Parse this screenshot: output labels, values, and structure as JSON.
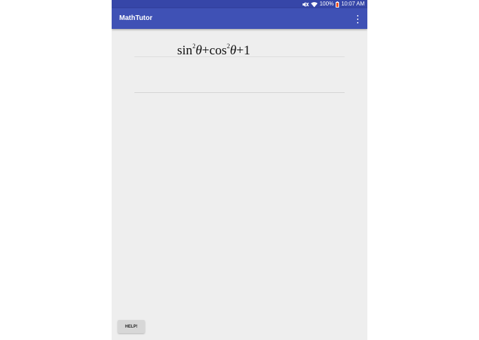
{
  "status_bar": {
    "battery_percent": "100%",
    "time": "10:07 AM",
    "icons": [
      "mute-icon",
      "wifi-icon",
      "battery-icon"
    ]
  },
  "app_bar": {
    "title": "MathTutor",
    "menu_icon": "overflow-menu-icon"
  },
  "expression": {
    "fn1": "sin",
    "exp1": "2",
    "var1": "θ",
    "op1": "+",
    "fn2": "cos",
    "exp2": "2",
    "var2": "θ",
    "op2": "+",
    "const": "1"
  },
  "help_button": {
    "label": "HELP!"
  },
  "colors": {
    "status_bar": "#3646a8",
    "app_bar": "#3f51b5",
    "background": "#eeeeee",
    "battery_accent": "#f4511e"
  }
}
